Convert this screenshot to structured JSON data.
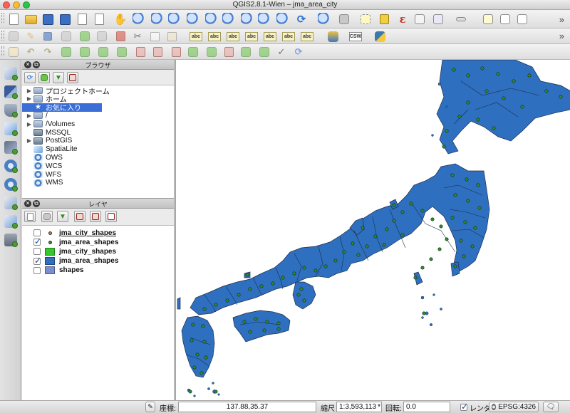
{
  "window": {
    "title": "QGIS2.8.1-Wien – jma_area_city"
  },
  "browser_panel": {
    "title": "ブラウザ",
    "items": [
      {
        "label": "プロジェクトホーム",
        "expandable": true,
        "icon": "folder-icon"
      },
      {
        "label": "ホーム",
        "expandable": true,
        "icon": "folder-icon"
      },
      {
        "label": "お気に入り",
        "expandable": false,
        "icon": "star-icon",
        "selected": true
      },
      {
        "label": "/",
        "expandable": true,
        "icon": "folder-icon"
      },
      {
        "label": "/Volumes",
        "expandable": true,
        "icon": "folder-icon"
      },
      {
        "label": "MSSQL",
        "expandable": false,
        "icon": "database-icon"
      },
      {
        "label": "PostGIS",
        "expandable": true,
        "icon": "database-icon"
      },
      {
        "label": "SpatiaLite",
        "expandable": false,
        "icon": "feather-icon"
      },
      {
        "label": "OWS",
        "expandable": false,
        "icon": "globe-icon"
      },
      {
        "label": "WCS",
        "expandable": false,
        "icon": "globe-icon"
      },
      {
        "label": "WFS",
        "expandable": false,
        "icon": "globe-icon"
      },
      {
        "label": "WMS",
        "expandable": false,
        "icon": "globe-icon"
      }
    ]
  },
  "layers_panel": {
    "title": "レイヤ",
    "layers": [
      {
        "name": "jma_city_shapes",
        "checked": false,
        "symbol": "point",
        "color": "#c77a3a",
        "underline": true
      },
      {
        "name": "jma_area_shapes",
        "checked": true,
        "symbol": "point",
        "color": "#2e8b2e",
        "underline": false
      },
      {
        "name": "jma_city_shapes",
        "checked": false,
        "symbol": "fill",
        "color": "#34c62a",
        "underline": false
      },
      {
        "name": "jma_area_shapes",
        "checked": true,
        "symbol": "fill",
        "color": "#2f6fbf",
        "underline": false
      },
      {
        "name": "shapes",
        "checked": false,
        "symbol": "fill",
        "color": "#7b8fd0",
        "underline": false
      }
    ]
  },
  "map": {
    "fill_color": "#2f6fbf",
    "point_color": "#2e8b2e"
  },
  "statusbar": {
    "coord_label": "座標:",
    "coord_value": "137.88,35.37",
    "scale_label": "縮尺",
    "scale_value": "1:3,593,113",
    "rotation_label": "回転:",
    "rotation_value": "0.0",
    "render_label": "レンダ",
    "render_checked": true,
    "crs_label": "EPSG:4326"
  }
}
